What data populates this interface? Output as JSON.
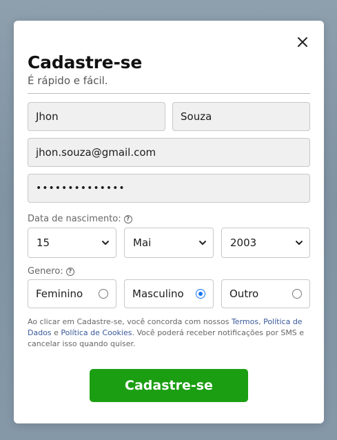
{
  "form": {
    "title": "Cadastre-se",
    "subtitle": "É rápido e fácil.",
    "first_name": "Jhon",
    "last_name": "Souza",
    "email": "jhon.souza@gmail.com",
    "password_mask": "••••••••••••••"
  },
  "birthdate": {
    "label": "Data de nascimento:",
    "day": "15",
    "month": "Mai",
    "year": "2003"
  },
  "gender": {
    "label": "Genero:",
    "options": [
      {
        "label": "Feminino",
        "selected": false
      },
      {
        "label": "Masculino",
        "selected": true
      },
      {
        "label": "Outro",
        "selected": false
      }
    ]
  },
  "terms": {
    "text_1": "Ao clicar em Cadastre-se, você concorda com nossos ",
    "link_1": "Termos",
    "text_2": ", ",
    "link_2": "Política de Dados",
    "text_3": " e ",
    "link_3": "Política de Cookies",
    "text_4": ". Você poderá receber notificações por SMS e cancelar isso quando quiser."
  },
  "submit_label": "Cadastre-se",
  "colors": {
    "accent_green": "#1c9e13",
    "link_blue": "#385898",
    "radio_blue": "#1877f2"
  },
  "icons": {
    "close": "close-icon",
    "help": "help-circle-icon",
    "chevron": "chevron-down-icon"
  }
}
